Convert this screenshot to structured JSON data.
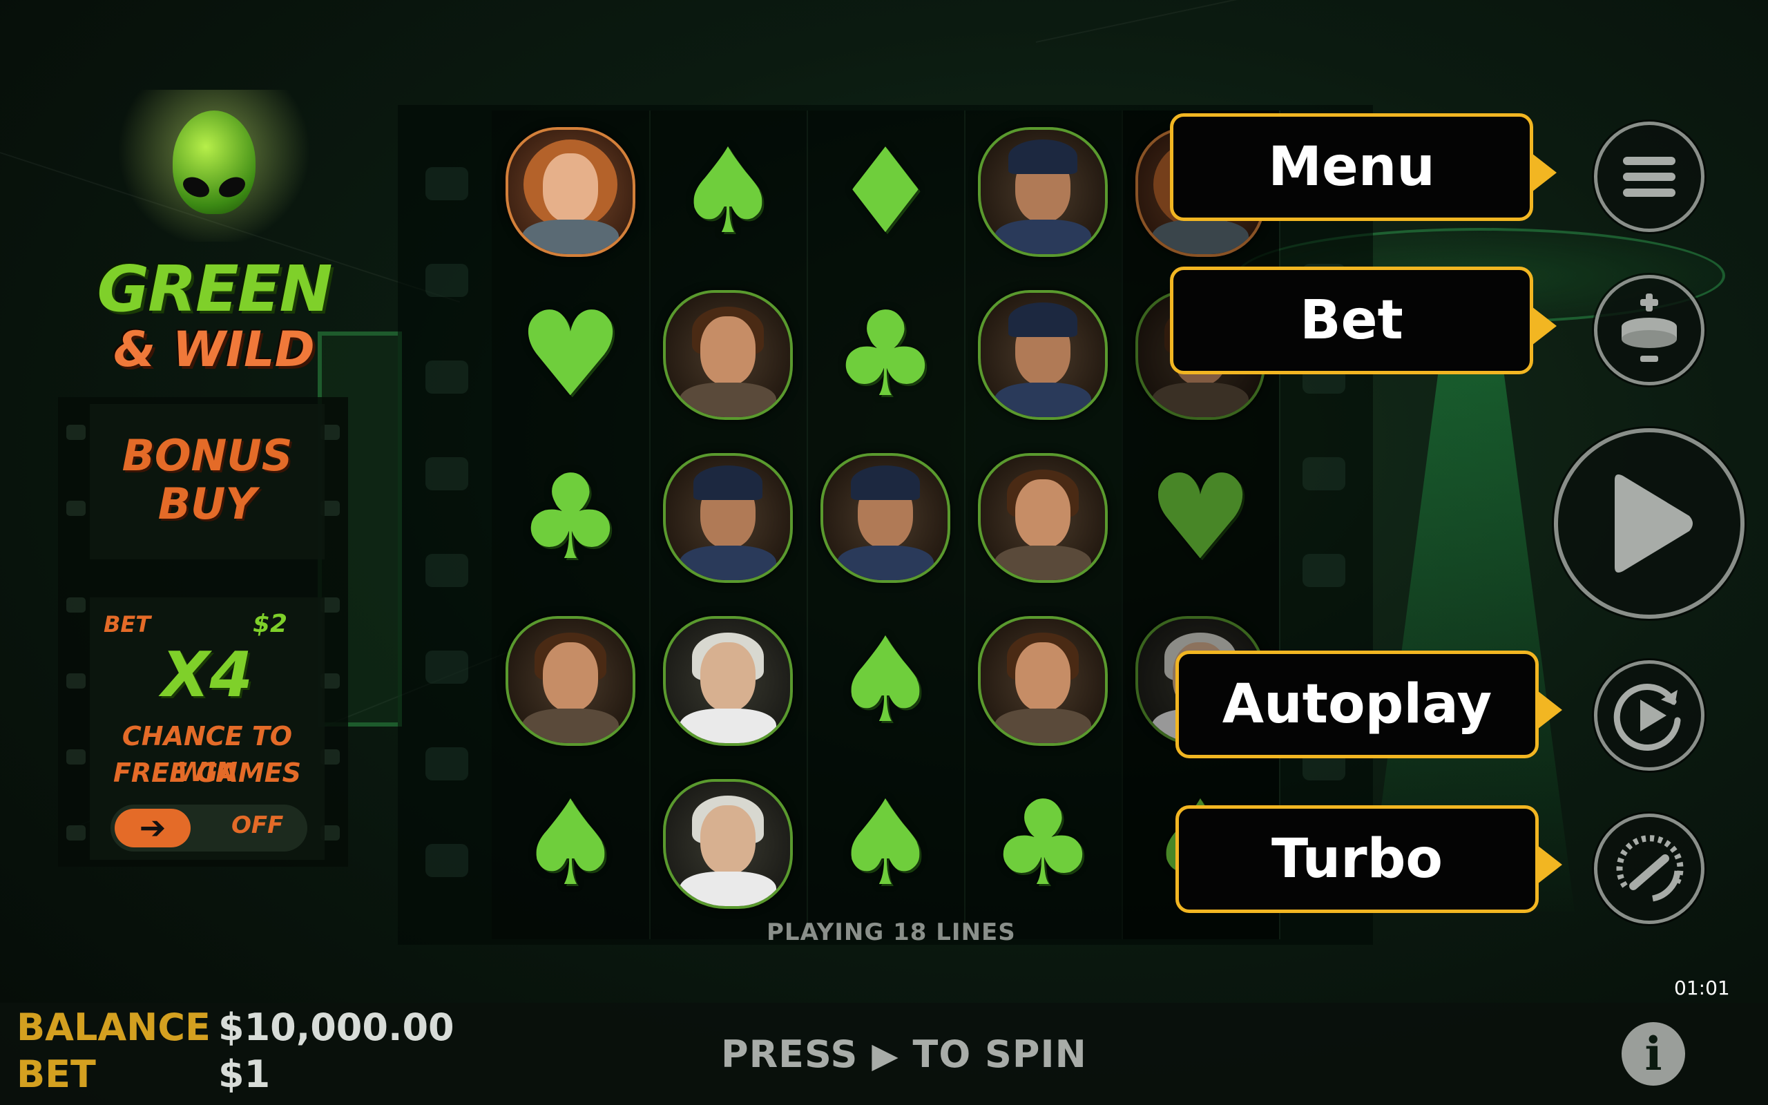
{
  "logo": {
    "line1": "GREEN",
    "line2": "& WILD"
  },
  "bonus_buy": {
    "label_line1": "BONUS",
    "label_line2": "BUY"
  },
  "ante_bet": {
    "bet_label": "BET",
    "bet_amount": "$2",
    "multiplier": "X4",
    "description_line1": "CHANCE TO WIN",
    "description_line2": "FREE GAMES",
    "toggle_icon": "arrow-right-icon",
    "toggle_state": "OFF"
  },
  "reels": {
    "columns": [
      [
        "woman-portrait",
        "heart",
        "club",
        "boy-portrait",
        "spade"
      ],
      [
        "spade",
        "boy-portrait",
        "cop-portrait",
        "old-man-portrait",
        "old-man-portrait"
      ],
      [
        "diamond",
        "club",
        "cop-portrait",
        "spade",
        "spade"
      ],
      [
        "cop-portrait",
        "cop-portrait",
        "boy-portrait",
        "boy-portrait",
        "club"
      ],
      [
        "woman-portrait",
        "boy-portrait",
        "heart",
        "old-man-portrait",
        "spade"
      ]
    ],
    "suit_color": "#6fce3c"
  },
  "status": {
    "lines_text": "PLAYING 18 LINES"
  },
  "controls": {
    "menu": {
      "callout": "Menu",
      "icon": "hamburger-menu-icon"
    },
    "bet": {
      "callout": "Bet",
      "icon": "bet-coin-icon"
    },
    "spin": {
      "icon": "play-icon"
    },
    "autoplay": {
      "callout": "Autoplay",
      "icon": "autoplay-icon"
    },
    "turbo": {
      "callout": "Turbo",
      "icon": "speedometer-icon"
    },
    "callout_border_color": "#f2b622"
  },
  "clock": "01:01",
  "footer": {
    "balance_label": "BALANCE",
    "balance_value": "$10,000.00",
    "bet_label": "BET",
    "bet_value": "$1",
    "press_word": "PRESS",
    "press_suffix": "TO SPIN",
    "info_icon": "info-icon"
  }
}
